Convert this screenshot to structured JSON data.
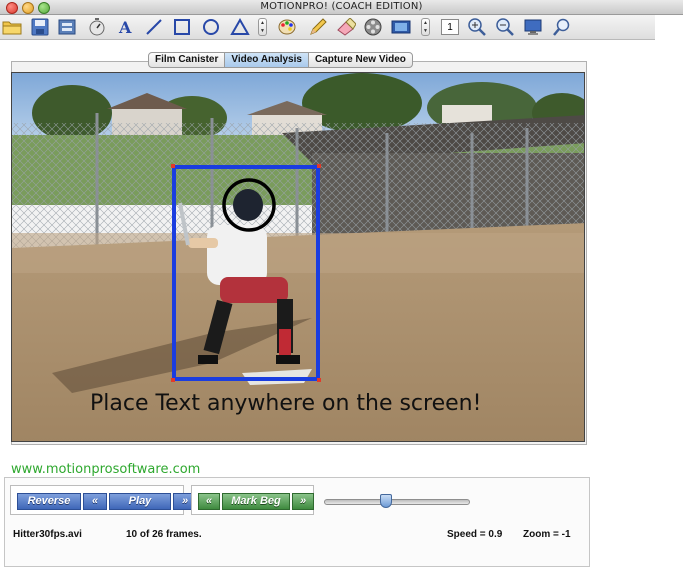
{
  "window": {
    "title": "MOTIONPRO! (COACH EDITION)"
  },
  "toolbar": {
    "icons": [
      "folder-icon",
      "save-icon",
      "film-strip-icon",
      "stopwatch-icon",
      "text-tool-icon",
      "line-tool-icon",
      "rectangle-tool-icon",
      "circle-tool-icon",
      "triangle-tool-icon",
      "color-palette-icon",
      "pencil-icon",
      "eraser-icon",
      "reel-icon",
      "video-clip-icon",
      "zoom-in-icon",
      "zoom-out-icon",
      "monitor-icon",
      "search-icon"
    ],
    "frame_step_value": "1"
  },
  "tabs": [
    {
      "label": "Film Canister",
      "active": false
    },
    {
      "label": "Video Analysis",
      "active": true
    },
    {
      "label": "Capture New Video",
      "active": false
    }
  ],
  "video": {
    "overlay_text": "Place Text anywhere on the screen!",
    "annotation_colors": {
      "rectangle": "#1a3de0",
      "circle": "#000000"
    }
  },
  "footer": {
    "url": "www.motionprosoftware.com"
  },
  "playback": {
    "reverse_label": "Reverse",
    "step_back_label": "«",
    "play_label": "Play",
    "step_forward_label": "»",
    "mark_back_label": "«",
    "mark_beg_label": "Mark Beg",
    "mark_forward_label": "»",
    "slider_position": 0.42
  },
  "status": {
    "filename": "Hitter30fps.avi",
    "frames": "10 of 26 frames.",
    "speed": "Speed = 0.9",
    "zoom": "Zoom =   -1"
  }
}
